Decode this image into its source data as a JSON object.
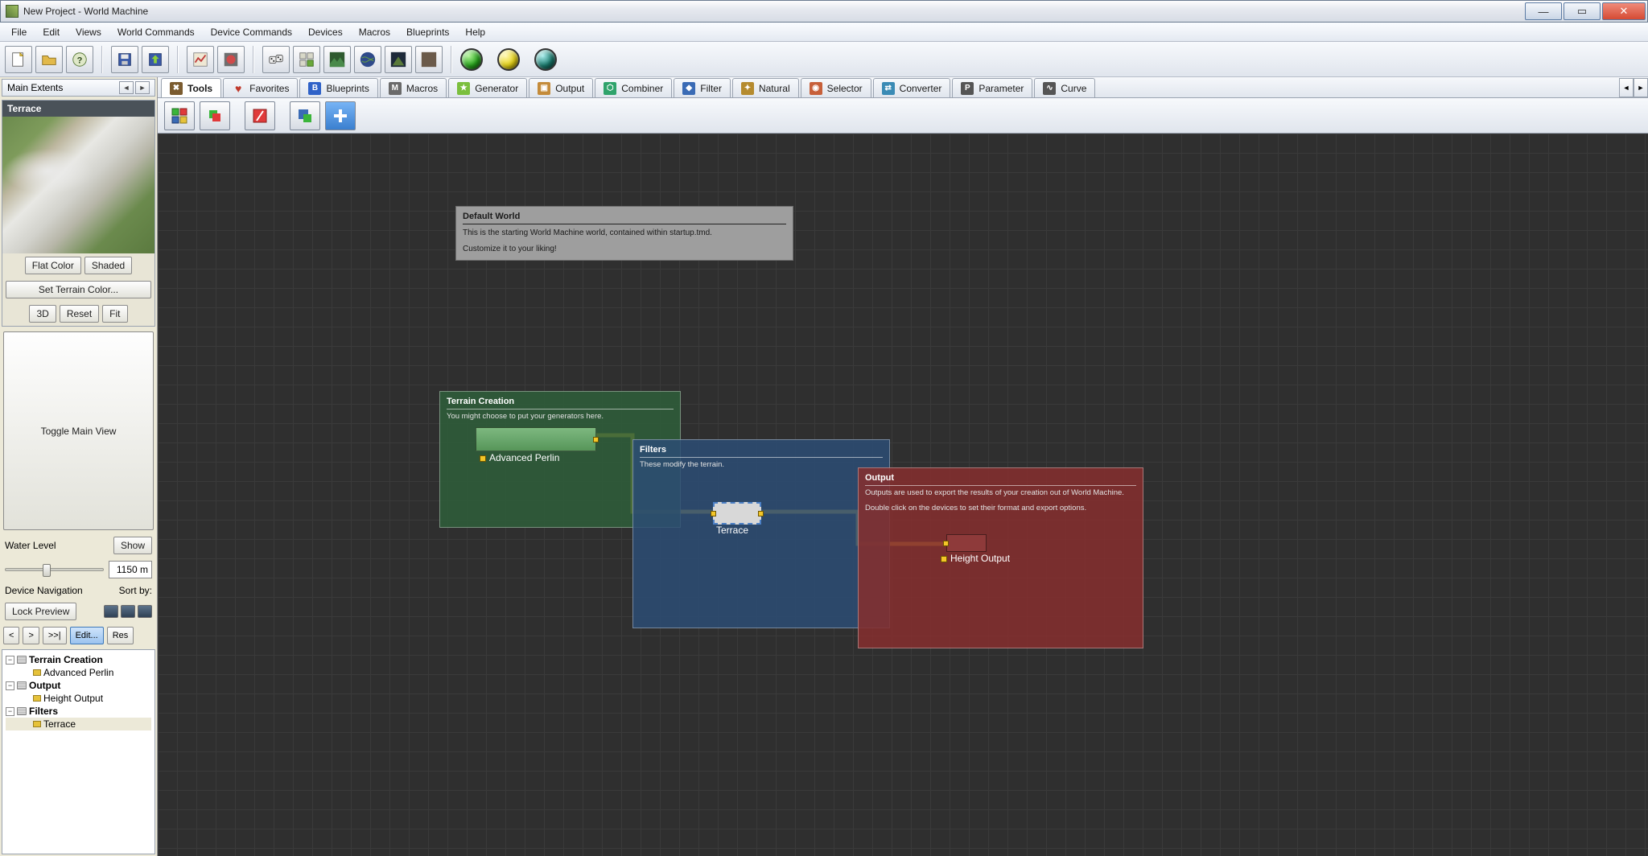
{
  "window": {
    "title": "New Project - World Machine"
  },
  "menu": {
    "items": [
      "File",
      "Edit",
      "Views",
      "World Commands",
      "Device Commands",
      "Devices",
      "Macros",
      "Blueprints",
      "Help"
    ]
  },
  "sidebar": {
    "extents_label": "Main Extents",
    "preview_title": "Terrace",
    "btn_flat": "Flat Color",
    "btn_shaded": "Shaded",
    "btn_set_color": "Set Terrain Color...",
    "btn_3d": "3D",
    "btn_reset": "Reset",
    "btn_fit": "Fit",
    "btn_toggle": "Toggle Main View",
    "water_label": "Water Level",
    "btn_show": "Show",
    "water_value": "1150 m",
    "devnav_label": "Device Navigation",
    "sortby_label": "Sort by:",
    "btn_lock": "Lock Preview",
    "nav_back": "<",
    "nav_fwd": ">",
    "nav_last": ">>|",
    "nav_edit": "Edit...",
    "nav_res": "Res",
    "tree": {
      "g1": "Terrain Creation",
      "g1a": "Advanced Perlin",
      "g2": "Output",
      "g2a": "Height Output",
      "g3": "Filters",
      "g3a": "Terrace"
    }
  },
  "tabs": {
    "items": [
      {
        "label": "Tools",
        "icon": "tools",
        "color": "#7a5b2f"
      },
      {
        "label": "Favorites",
        "icon": "heart",
        "color": "#c0392b"
      },
      {
        "label": "Blueprints",
        "icon": "B",
        "color": "#2f62c8"
      },
      {
        "label": "Macros",
        "icon": "M",
        "color": "#6a6a6a"
      },
      {
        "label": "Generator",
        "icon": "G",
        "color": "#7bbf3d"
      },
      {
        "label": "Output",
        "icon": "O",
        "color": "#c48b3a"
      },
      {
        "label": "Combiner",
        "icon": "C",
        "color": "#2fa36b"
      },
      {
        "label": "Filter",
        "icon": "F",
        "color": "#3a6bb5"
      },
      {
        "label": "Natural",
        "icon": "N",
        "color": "#b58b2f"
      },
      {
        "label": "Selector",
        "icon": "S",
        "color": "#c7603a"
      },
      {
        "label": "Converter",
        "icon": "V",
        "color": "#3a8bb5"
      },
      {
        "label": "Parameter",
        "icon": "P",
        "color": "#555"
      },
      {
        "label": "Curve",
        "icon": "Cv",
        "color": "#555"
      }
    ]
  },
  "canvas": {
    "note": {
      "title": "Default World",
      "line1": "This is the starting World Machine world, contained within startup.tmd.",
      "line2": "Customize it to your liking!"
    },
    "group_tc": {
      "title": "Terrain Creation",
      "desc": "You might choose to put your generators here."
    },
    "group_fl": {
      "title": "Filters",
      "desc": "These modify the terrain."
    },
    "group_ou": {
      "title": "Output",
      "desc1": "Outputs are used to export the results of your creation out of World Machine.",
      "desc2": "Double click on the devices to set their format and export options."
    },
    "node_perlin": "Advanced Perlin",
    "node_terrace": "Terrace",
    "node_height": "Height Output"
  }
}
